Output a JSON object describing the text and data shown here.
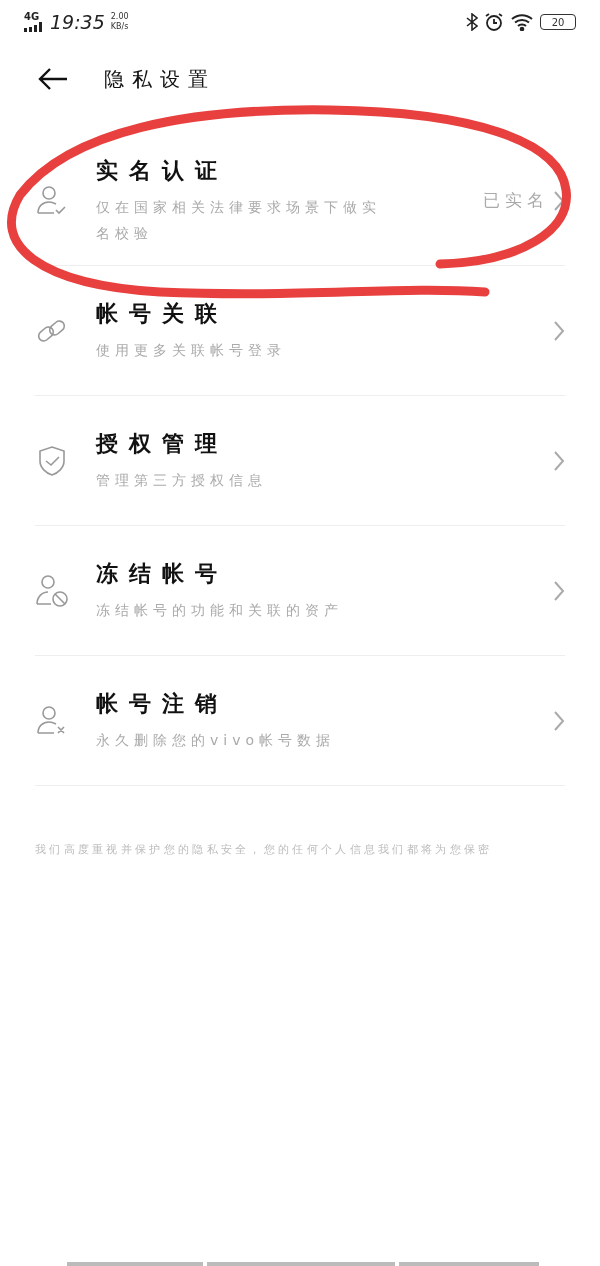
{
  "status_bar": {
    "network": "4G",
    "time": "19:35",
    "speed_value": "2.00",
    "speed_unit": "KB/s",
    "battery": "20"
  },
  "header": {
    "title": "隐私设置"
  },
  "items": [
    {
      "title": "实名认证",
      "subtitle": "仅在国家相关法律要求场景下做实名校验",
      "value": "已实名"
    },
    {
      "title": "帐号关联",
      "subtitle": "使用更多关联帐号登录"
    },
    {
      "title": "授权管理",
      "subtitle": "管理第三方授权信息"
    },
    {
      "title": "冻结帐号",
      "subtitle": "冻结帐号的功能和关联的资产"
    },
    {
      "title": "帐号注销",
      "subtitle": "永久删除您的vivo帐号数据"
    }
  ],
  "footer": "我们高度重视并保护您的隐私安全，您的任何个人信息我们都将为您保密"
}
